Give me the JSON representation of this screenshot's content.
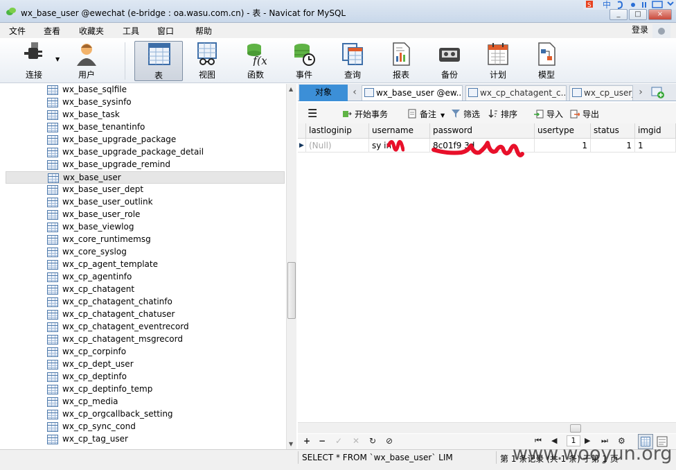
{
  "window": {
    "title": "wx_base_user @ewechat (e-bridge : oa.wasu.com.cn) - 表 - Navicat for MySQL",
    "controls": [
      "_",
      "□",
      "×"
    ]
  },
  "ime": {
    "label": "中"
  },
  "menu": {
    "items": [
      "文件",
      "查看",
      "收藏夹",
      "工具",
      "窗口",
      "帮助"
    ],
    "login": "登录"
  },
  "toolbar": {
    "buttons": [
      {
        "label": "连接",
        "icon": "plug-icon"
      },
      {
        "label": "用户",
        "icon": "user-icon"
      },
      {
        "label": "表",
        "icon": "table-icon"
      },
      {
        "label": "视图",
        "icon": "view-icon"
      },
      {
        "label": "函数",
        "icon": "function-icon"
      },
      {
        "label": "事件",
        "icon": "event-icon"
      },
      {
        "label": "查询",
        "icon": "query-icon"
      },
      {
        "label": "报表",
        "icon": "report-icon"
      },
      {
        "label": "备份",
        "icon": "backup-icon"
      },
      {
        "label": "计划",
        "icon": "schedule-icon"
      },
      {
        "label": "模型",
        "icon": "model-icon"
      }
    ]
  },
  "tree": {
    "selected": "wx_base_user",
    "items": [
      "wx_base_sqlfile",
      "wx_base_sysinfo",
      "wx_base_task",
      "wx_base_tenantinfo",
      "wx_base_upgrade_package",
      "wx_base_upgrade_package_detail",
      "wx_base_upgrade_remind",
      "wx_base_user",
      "wx_base_user_dept",
      "wx_base_user_outlink",
      "wx_base_user_role",
      "wx_base_viewlog",
      "wx_core_runtimemsg",
      "wx_core_syslog",
      "wx_cp_agent_template",
      "wx_cp_agentinfo",
      "wx_cp_chatagent",
      "wx_cp_chatagent_chatinfo",
      "wx_cp_chatagent_chatuser",
      "wx_cp_chatagent_eventrecord",
      "wx_cp_chatagent_msgrecord",
      "wx_cp_corpinfo",
      "wx_cp_dept_user",
      "wx_cp_deptinfo",
      "wx_cp_deptinfo_temp",
      "wx_cp_media",
      "wx_cp_orgcallback_setting",
      "wx_cp_sync_cond",
      "wx_cp_tag_user"
    ]
  },
  "tabs": {
    "objects_label": "对象",
    "items": [
      "wx_base_user @ew...",
      "wx_cp_chatagent_c...",
      "wx_cp_user_..."
    ]
  },
  "grid_toolbar": {
    "menu_icon": "hamburger-icon",
    "begin_transaction": "开始事务",
    "memo": "备注",
    "filter": "筛选",
    "sort": "排序",
    "import": "导入",
    "export": "导出"
  },
  "grid": {
    "columns": [
      "lastloginip",
      "username",
      "password",
      "usertype",
      "status",
      "imgid"
    ],
    "row": {
      "lastloginip": "(Null)",
      "username": "sy  in",
      "password": "8c01f9                3d",
      "usertype": "1",
      "status": "1",
      "imgid": "1"
    },
    "redaction_color": "#e8102a"
  },
  "navbar": {
    "page": "1"
  },
  "status": {
    "sql": "SELECT * FROM `wx_base_user` LIM",
    "records": "第 1 条记录 (共 1 条) 于第 1 页",
    "watermark": "www.wooyun.org"
  }
}
